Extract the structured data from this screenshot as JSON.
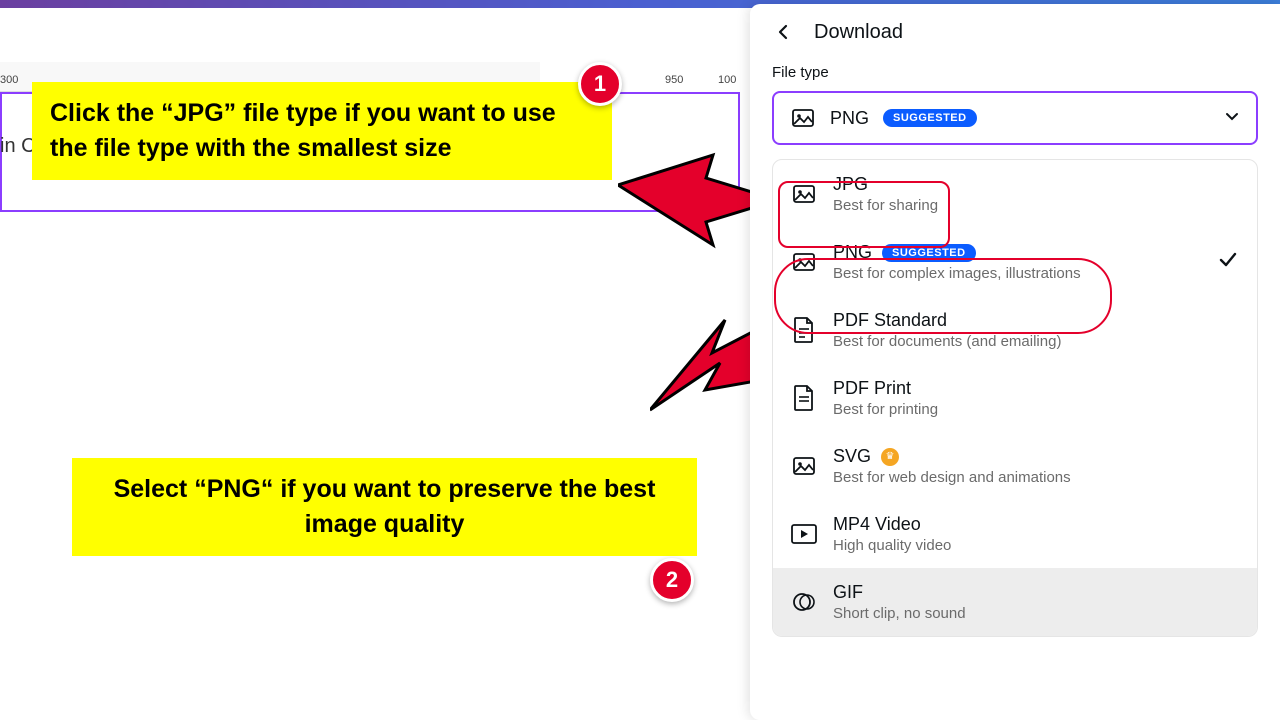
{
  "topbar": {},
  "ruler": {
    "marks": [
      "300",
      "950",
      "100"
    ],
    "canvas_label": "in C"
  },
  "callouts": {
    "one": "Click the “JPG” file type if you want to use the file type with the smallest size",
    "two": "Select “PNG“ if you want to preserve the best image quality",
    "badge1": "1",
    "badge2": "2"
  },
  "panel": {
    "title": "Download",
    "field_label": "File type",
    "selected": {
      "name": "PNG",
      "suggested": "SUGGESTED"
    },
    "options": [
      {
        "name": "JPG",
        "desc": "Best for sharing",
        "icon": "image",
        "suggested": false,
        "checked": false,
        "premium": false
      },
      {
        "name": "PNG",
        "desc": "Best for complex images, illustrations",
        "icon": "image",
        "suggested": true,
        "checked": true,
        "premium": false
      },
      {
        "name": "PDF Standard",
        "desc": "Best for documents (and emailing)",
        "icon": "doc",
        "suggested": false,
        "checked": false,
        "premium": false
      },
      {
        "name": "PDF Print",
        "desc": "Best for printing",
        "icon": "doc",
        "suggested": false,
        "checked": false,
        "premium": false
      },
      {
        "name": "SVG",
        "desc": "Best for web design and animations",
        "icon": "image",
        "suggested": false,
        "checked": false,
        "premium": true
      },
      {
        "name": "MP4 Video",
        "desc": "High quality video",
        "icon": "video",
        "suggested": false,
        "checked": false,
        "premium": false
      },
      {
        "name": "GIF",
        "desc": "Short clip, no sound",
        "icon": "gif",
        "suggested": false,
        "checked": false,
        "premium": false
      }
    ],
    "suggested_label": "SUGGESTED"
  }
}
